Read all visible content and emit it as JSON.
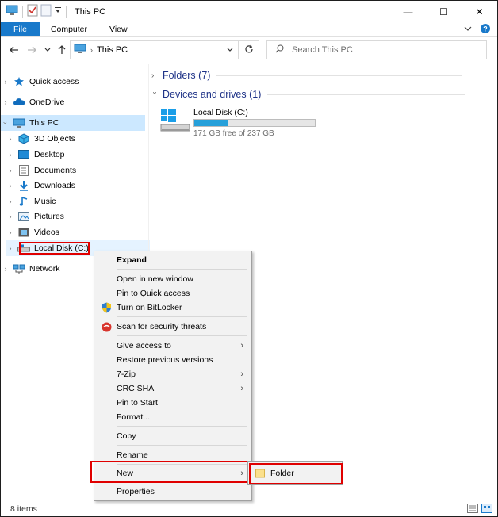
{
  "window": {
    "title": "This PC",
    "controls": {
      "minimize": "—",
      "maximize": "☐",
      "close": "✕"
    }
  },
  "ribbon": {
    "tabs": [
      "File",
      "Computer",
      "View"
    ]
  },
  "address_bar": {
    "path": "This PC",
    "search_placeholder": "Search This PC"
  },
  "nav_pane": {
    "items": [
      {
        "label": "Quick access",
        "icon": "star-icon",
        "state": "normal"
      },
      {
        "label": "OneDrive",
        "icon": "cloud-icon",
        "state": "normal"
      },
      {
        "label": "This PC",
        "icon": "computer-icon",
        "state": "selected"
      },
      {
        "label": "3D Objects",
        "icon": "cube-icon",
        "state": "normal"
      },
      {
        "label": "Desktop",
        "icon": "desktop-icon",
        "state": "normal"
      },
      {
        "label": "Documents",
        "icon": "document-icon",
        "state": "normal"
      },
      {
        "label": "Downloads",
        "icon": "download-icon",
        "state": "normal"
      },
      {
        "label": "Music",
        "icon": "music-icon",
        "state": "normal"
      },
      {
        "label": "Pictures",
        "icon": "picture-icon",
        "state": "normal"
      },
      {
        "label": "Videos",
        "icon": "video-icon",
        "state": "normal"
      },
      {
        "label": "Local Disk (C:)",
        "icon": "drive-icon",
        "state": "hover"
      },
      {
        "label": "Network",
        "icon": "network-icon",
        "state": "normal"
      }
    ]
  },
  "content": {
    "folders_group": "Folders (7)",
    "drives_group": "Devices and drives (1)",
    "drive": {
      "name": "Local Disk (C:)",
      "free_text": "171 GB free of 237 GB",
      "used_fraction": 0.28
    }
  },
  "status_bar": {
    "item_count": "8 items"
  },
  "context_menu": {
    "items": {
      "expand": "Expand",
      "open_new_window": "Open in new window",
      "pin_quick_access": "Pin to Quick access",
      "bitlocker": "Turn on BitLocker",
      "scan": "Scan for security threats",
      "give_access": "Give access to",
      "restore": "Restore previous versions",
      "zip": "7-Zip",
      "crc": "CRC SHA",
      "pin_start": "Pin to Start",
      "format": "Format...",
      "copy": "Copy",
      "rename": "Rename",
      "new": "New",
      "properties": "Properties"
    },
    "submenu_folder": "Folder"
  },
  "colors": {
    "accent": "#1979ca",
    "selected_bg": "#cce8ff",
    "highlight_red": "#e00000",
    "group_text": "#1e3287",
    "bar_fill": "#26a0da"
  }
}
